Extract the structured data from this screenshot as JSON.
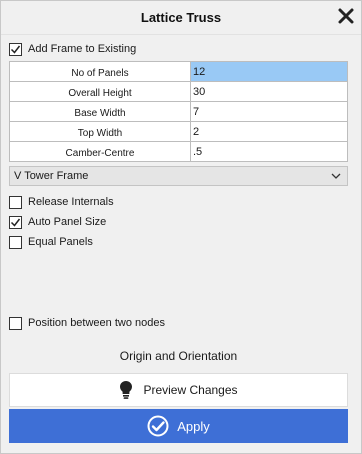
{
  "window": {
    "title": "Lattice Truss"
  },
  "options": {
    "add_frame": {
      "label": "Add Frame to Existing",
      "checked": true
    },
    "release_internals": {
      "label": "Release Internals",
      "checked": false
    },
    "auto_panel_size": {
      "label": "Auto Panel Size",
      "checked": true
    },
    "equal_panels": {
      "label": "Equal Panels",
      "checked": false
    },
    "position_between_nodes": {
      "label": "Position between two nodes",
      "checked": false
    }
  },
  "parameters": [
    {
      "label": "No of Panels",
      "value": "12",
      "selected": true
    },
    {
      "label": "Overall Height",
      "value": "30",
      "selected": false
    },
    {
      "label": "Base Width",
      "value": "7",
      "selected": false
    },
    {
      "label": "Top Width",
      "value": "2",
      "selected": false
    },
    {
      "label": "Camber-Centre",
      "value": ".5",
      "selected": false
    }
  ],
  "frame_type": {
    "selected": "V Tower Frame"
  },
  "buttons": {
    "origin_label": "Origin and Orientation",
    "preview_label": "Preview Changes",
    "apply_label": "Apply"
  },
  "icons": {
    "close": "close-icon",
    "chevron": "chevron-down-icon",
    "bulb": "lightbulb-icon",
    "apply": "check-circle-icon"
  },
  "colors": {
    "accent": "#3e6fd6",
    "selection": "#99c9f5",
    "panel_bg": "#f0f0f0"
  }
}
